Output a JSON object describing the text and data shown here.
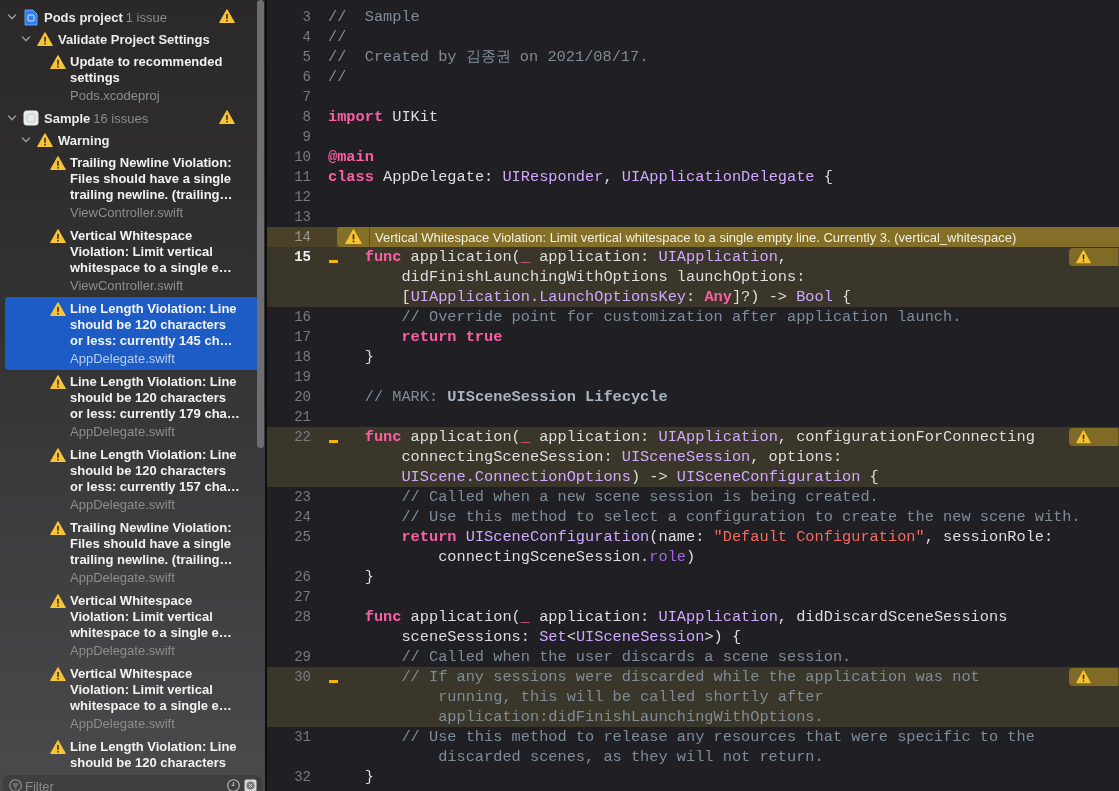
{
  "navigator": {
    "groups": [
      {
        "title": "Pods project",
        "count": "1 issue",
        "kind": "project",
        "expanded": true,
        "children": [
          {
            "title": "Validate Project Settings",
            "expanded": true,
            "issues": [
              {
                "message": "Update to recommended settings",
                "file": "Pods.xcodeproj",
                "selected": false
              }
            ]
          }
        ]
      },
      {
        "title": "Sample",
        "count": "16 issues",
        "kind": "target",
        "expanded": true,
        "children": [
          {
            "title": "Warning",
            "expanded": true,
            "issues": [
              {
                "message": "Trailing Newline Violation: Files should have a single trailing newline. (trailing…",
                "file": "ViewController.swift",
                "selected": false
              },
              {
                "message": "Vertical Whitespace Violation: Limit vertical whitespace to a single e…",
                "file": "ViewController.swift",
                "selected": false
              },
              {
                "message": "Line Length Violation: Line should be 120 characters or less: currently 145 ch…",
                "file": "AppDelegate.swift",
                "selected": true
              },
              {
                "message": "Line Length Violation: Line should be 120 characters or less: currently 179 cha…",
                "file": "AppDelegate.swift",
                "selected": false
              },
              {
                "message": "Line Length Violation: Line should be 120 characters or less: currently 157 cha…",
                "file": "AppDelegate.swift",
                "selected": false
              },
              {
                "message": "Trailing Newline Violation: Files should have a single trailing newline. (trailing…",
                "file": "AppDelegate.swift",
                "selected": false
              },
              {
                "message": "Vertical Whitespace Violation: Limit vertical whitespace to a single e…",
                "file": "AppDelegate.swift",
                "selected": false
              },
              {
                "message": "Vertical Whitespace Violation: Limit vertical whitespace to a single e…",
                "file": "AppDelegate.swift",
                "selected": false
              },
              {
                "message": "Line Length Violation: Line should be 120 characters",
                "selected": false
              }
            ]
          }
        ]
      }
    ],
    "filter": {
      "placeholder": "Filter"
    }
  },
  "editor": {
    "lines": [
      {
        "number": "3",
        "rows": [
          {
            "tokens": [
              {
                "kind": "comment",
                "text": "//  Sample"
              }
            ]
          }
        ]
      },
      {
        "number": "4",
        "rows": [
          {
            "tokens": [
              {
                "kind": "comment",
                "text": "//"
              }
            ]
          }
        ]
      },
      {
        "number": "5",
        "rows": [
          {
            "tokens": [
              {
                "kind": "comment",
                "text": "//  Created by 김종권 on 2021/08/17."
              }
            ]
          }
        ]
      },
      {
        "number": "6",
        "rows": [
          {
            "tokens": [
              {
                "kind": "comment",
                "text": "//"
              }
            ]
          }
        ]
      },
      {
        "number": "7"
      },
      {
        "number": "8",
        "rows": [
          {
            "tokens": [
              {
                "kind": "kw",
                "text": "import"
              },
              {
                "kind": "plain",
                "text": " UIKit"
              }
            ]
          }
        ]
      },
      {
        "number": "9"
      },
      {
        "number": "10",
        "rows": [
          {
            "tokens": [
              {
                "kind": "kw",
                "text": "@main"
              }
            ]
          }
        ]
      },
      {
        "number": "11",
        "rows": [
          {
            "tokens": [
              {
                "kind": "kw",
                "text": "class"
              },
              {
                "kind": "plain",
                "text": " AppDelegate: "
              },
              {
                "kind": "type",
                "text": "UIResponder"
              },
              {
                "kind": "plain",
                "text": ", "
              },
              {
                "kind": "type",
                "text": "UIApplicationDelegate"
              },
              {
                "kind": "plain",
                "text": " {"
              }
            ]
          }
        ]
      },
      {
        "number": "12"
      },
      {
        "number": "13"
      },
      {
        "number": "14",
        "banner": "Vertical Whitespace Violation: Limit vertical whitespace to a single empty line. Currently 3. (vertical_whitespace)"
      },
      {
        "number": "15",
        "warning": true,
        "current": true,
        "rows": [
          {
            "tokens": [
              {
                "kind": "kw",
                "text": "    func"
              },
              {
                "kind": "plain",
                "text": " application("
              },
              {
                "kind": "kw",
                "text": "_"
              },
              {
                "kind": "plain",
                "text": " application: "
              },
              {
                "kind": "type",
                "text": "UIApplication"
              },
              {
                "kind": "plain",
                "text": ","
              }
            ]
          },
          {
            "tokens": [
              {
                "kind": "plain",
                "text": "        didFinishLaunchingWithOptions launchOptions:"
              }
            ]
          },
          {
            "tokens": [
              {
                "kind": "plain",
                "text": "        ["
              },
              {
                "kind": "type",
                "text": "UIApplication.LaunchOptionsKey"
              },
              {
                "kind": "plain",
                "text": ": "
              },
              {
                "kind": "kw",
                "text": "Any"
              },
              {
                "kind": "plain",
                "text": "]?) -> "
              },
              {
                "kind": "type",
                "text": "Bool"
              },
              {
                "kind": "plain",
                "text": " {"
              }
            ]
          }
        ]
      },
      {
        "number": "16",
        "rows": [
          {
            "tokens": [
              {
                "kind": "comment",
                "text": "        // Override point for customization after application launch."
              }
            ]
          }
        ]
      },
      {
        "number": "17",
        "rows": [
          {
            "tokens": [
              {
                "kind": "kw",
                "text": "        return true"
              }
            ]
          }
        ]
      },
      {
        "number": "18",
        "rows": [
          {
            "tokens": [
              {
                "kind": "plain",
                "text": "    }"
              }
            ]
          }
        ]
      },
      {
        "number": "19"
      },
      {
        "number": "20",
        "rows": [
          {
            "tokens": [
              {
                "kind": "comment",
                "text": "    // MARK: "
              },
              {
                "kind": "mark",
                "text": "UISceneSession Lifecycle"
              }
            ]
          }
        ]
      },
      {
        "number": "21"
      },
      {
        "number": "22",
        "warning": true,
        "current": false,
        "rows": [
          {
            "tokens": [
              {
                "kind": "kw",
                "text": "    func"
              },
              {
                "kind": "plain",
                "text": " application("
              },
              {
                "kind": "kw",
                "text": "_"
              },
              {
                "kind": "plain",
                "text": " application: "
              },
              {
                "kind": "type",
                "text": "UIApplication"
              },
              {
                "kind": "plain",
                "text": ", configurationForConnecting"
              }
            ]
          },
          {
            "tokens": [
              {
                "kind": "plain",
                "text": "        connectingSceneSession: "
              },
              {
                "kind": "type",
                "text": "UISceneSession"
              },
              {
                "kind": "plain",
                "text": ", options:"
              }
            ]
          },
          {
            "tokens": [
              {
                "kind": "type",
                "text": "        UIScene.ConnectionOptions"
              },
              {
                "kind": "plain",
                "text": ") -> "
              },
              {
                "kind": "type",
                "text": "UISceneConfiguration"
              },
              {
                "kind": "plain",
                "text": " {"
              }
            ]
          }
        ]
      },
      {
        "number": "23",
        "rows": [
          {
            "tokens": [
              {
                "kind": "comment",
                "text": "        // Called when a new scene session is being created."
              }
            ]
          }
        ]
      },
      {
        "number": "24",
        "rows": [
          {
            "tokens": [
              {
                "kind": "comment",
                "text": "        // Use this method to select a configuration to create the new scene with."
              }
            ]
          }
        ]
      },
      {
        "number": "25",
        "rows": [
          {
            "tokens": [
              {
                "kind": "kw",
                "text": "        return "
              },
              {
                "kind": "type",
                "text": "UISceneConfiguration"
              },
              {
                "kind": "plain",
                "text": "(name: "
              },
              {
                "kind": "string",
                "text": "\"Default Configuration\""
              },
              {
                "kind": "plain",
                "text": ", sessionRole:"
              }
            ]
          },
          {
            "tokens": [
              {
                "kind": "plain",
                "text": "            connectingSceneSession."
              },
              {
                "kind": "member",
                "text": "role"
              },
              {
                "kind": "plain",
                "text": ")"
              }
            ]
          }
        ]
      },
      {
        "number": "26",
        "rows": [
          {
            "tokens": [
              {
                "kind": "plain",
                "text": "    }"
              }
            ]
          }
        ]
      },
      {
        "number": "27"
      },
      {
        "number": "28",
        "rows": [
          {
            "tokens": [
              {
                "kind": "kw",
                "text": "    func"
              },
              {
                "kind": "plain",
                "text": " application("
              },
              {
                "kind": "kw",
                "text": "_"
              },
              {
                "kind": "plain",
                "text": " application: "
              },
              {
                "kind": "type",
                "text": "UIApplication"
              },
              {
                "kind": "plain",
                "text": ", didDiscardSceneSessions"
              }
            ]
          },
          {
            "tokens": [
              {
                "kind": "plain",
                "text": "        sceneSessions: "
              },
              {
                "kind": "type",
                "text": "Set"
              },
              {
                "kind": "plain",
                "text": "<"
              },
              {
                "kind": "type",
                "text": "UISceneSession"
              },
              {
                "kind": "plain",
                "text": ">) {"
              }
            ]
          }
        ]
      },
      {
        "number": "29",
        "rows": [
          {
            "tokens": [
              {
                "kind": "comment",
                "text": "        // Called when the user discards a scene session."
              }
            ]
          }
        ]
      },
      {
        "number": "30",
        "warning": true,
        "current": false,
        "rows": [
          {
            "tokens": [
              {
                "kind": "comment",
                "text": "        // If any sessions were discarded while the application was not"
              }
            ]
          },
          {
            "tokens": [
              {
                "kind": "comment",
                "text": "            running, this will be called shortly after"
              }
            ]
          },
          {
            "tokens": [
              {
                "kind": "comment",
                "text": "            application:didFinishLaunchingWithOptions."
              }
            ]
          }
        ]
      },
      {
        "number": "31",
        "rows": [
          {
            "tokens": [
              {
                "kind": "comment",
                "text": "        // Use this method to release any resources that were specific to the"
              }
            ]
          },
          {
            "tokens": [
              {
                "kind": "comment",
                "text": "            discarded scenes, as they will not return."
              }
            ]
          }
        ]
      },
      {
        "number": "32",
        "rows": [
          {
            "tokens": [
              {
                "kind": "plain",
                "text": "    }"
              }
            ]
          }
        ]
      }
    ]
  }
}
